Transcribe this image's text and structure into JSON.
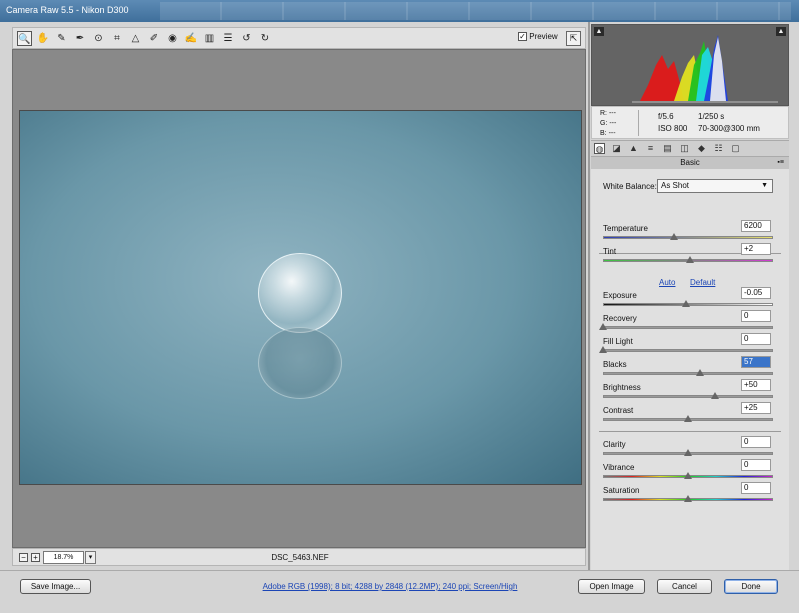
{
  "window": {
    "title": "Camera Raw 5.5  -  Nikon D300"
  },
  "toolbar": {
    "tools": [
      {
        "name": "zoom-tool-icon",
        "glyph": "🔍"
      },
      {
        "name": "hand-tool-icon",
        "glyph": "✋"
      },
      {
        "name": "white-balance-tool-icon",
        "glyph": "✎"
      },
      {
        "name": "color-sampler-tool-icon",
        "glyph": "✒"
      },
      {
        "name": "target-adjustment-tool-icon",
        "glyph": "⊙"
      },
      {
        "name": "crop-tool-icon",
        "glyph": "⌗"
      },
      {
        "name": "straighten-tool-icon",
        "glyph": "△"
      },
      {
        "name": "spot-removal-tool-icon",
        "glyph": "✐"
      },
      {
        "name": "red-eye-tool-icon",
        "glyph": "◉"
      },
      {
        "name": "adjustment-brush-icon",
        "glyph": "✍"
      },
      {
        "name": "graduated-filter-icon",
        "glyph": "▥"
      },
      {
        "name": "preferences-icon",
        "glyph": "☰"
      },
      {
        "name": "rotate-ccw-icon",
        "glyph": "↺"
      },
      {
        "name": "rotate-cw-icon",
        "glyph": "↻"
      }
    ],
    "preview_label": "Preview",
    "preview_checked": "✓",
    "fullscreen_glyph": "⇱"
  },
  "preview": {
    "zoom_minus": "−",
    "zoom_plus": "+",
    "zoom_value": "18.7%",
    "zoom_dropdown": "▾",
    "filename": "DSC_5463.NEF"
  },
  "histogram": {
    "clip_shadow": "▲",
    "clip_highlight": "▲"
  },
  "camera_info": {
    "r_label": "R:",
    "r_value": "---",
    "g_label": "G:",
    "g_value": "---",
    "b_label": "B:",
    "b_value": "---",
    "aperture": "f/5.6",
    "shutter": "1/250 s",
    "iso": "ISO 800",
    "lens": "70-300@300 mm"
  },
  "panel": {
    "tabs": [
      "◍",
      "◪",
      "▲",
      "≡",
      "▤",
      "◫",
      "◆",
      "☷",
      "▢"
    ],
    "title": "Basic",
    "menu_glyph": "▪≡"
  },
  "basic": {
    "white_balance_label": "White Balance:",
    "white_balance_value": "As Shot",
    "dropdown_arrow": "▼",
    "auto_label": "Auto",
    "default_label": "Default",
    "sliders": [
      {
        "key": "temperature",
        "label": "Temperature",
        "value": "6200",
        "level": 0.42
      },
      {
        "key": "tint",
        "label": "Tint",
        "value": "+2",
        "level": 0.51
      },
      {
        "key": "exposure",
        "label": "Exposure",
        "value": "-0.05",
        "level": 0.49
      },
      {
        "key": "recovery",
        "label": "Recovery",
        "value": "0",
        "level": 0.0
      },
      {
        "key": "fill-light",
        "label": "Fill Light",
        "value": "0",
        "level": 0.0
      },
      {
        "key": "blacks",
        "label": "Blacks",
        "value": "57",
        "level": 0.57
      },
      {
        "key": "brightness",
        "label": "Brightness",
        "value": "+50",
        "level": 0.66
      },
      {
        "key": "contrast",
        "label": "Contrast",
        "value": "+25",
        "level": 0.5
      },
      {
        "key": "clarity",
        "label": "Clarity",
        "value": "0",
        "level": 0.5
      },
      {
        "key": "vibrance",
        "label": "Vibrance",
        "value": "0",
        "level": 0.5
      },
      {
        "key": "saturation",
        "label": "Saturation",
        "value": "0",
        "level": 0.5
      }
    ]
  },
  "footer": {
    "save_label": "Save Image...",
    "workflow_link": "Adobe RGB (1998); 8 bit; 4288 by 2848 (12.2MP); 240 ppi; Screen/High",
    "open_label": "Open Image",
    "cancel_label": "Cancel",
    "done_label": "Done"
  },
  "colors": {
    "accent_blue": "#1b45b5",
    "selection": "#3a74c9"
  }
}
